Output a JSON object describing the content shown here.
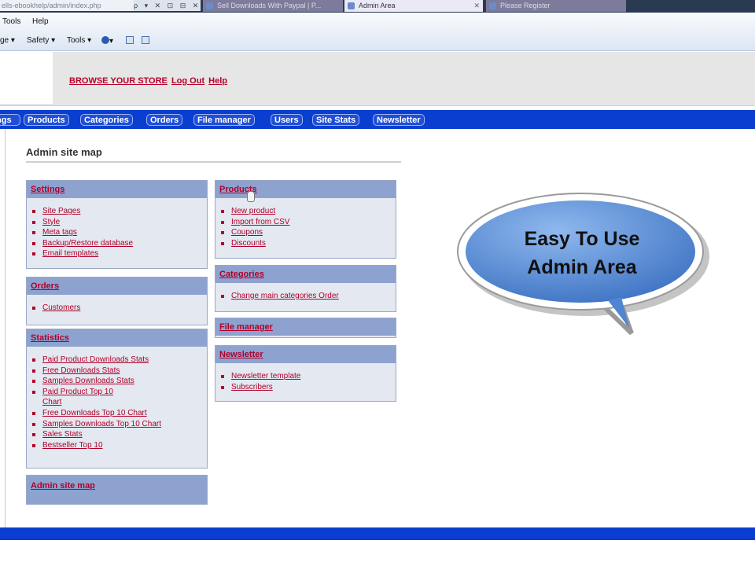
{
  "browser": {
    "address": "ells-ebookhelp/admin/index.php",
    "tabs": [
      "Sell Downloads With Paypal | P...",
      "Admin Area",
      "Please Register"
    ],
    "menu": [
      "Tools",
      "Help"
    ],
    "toolbar": [
      "ge ▾",
      "Safety ▾",
      "Tools ▾",
      "▾"
    ]
  },
  "header": {
    "links": [
      "BROWSE YOUR STORE",
      "Log Out",
      "Help"
    ]
  },
  "nav": {
    "items": [
      "ngs",
      "Products",
      "Categories",
      "Orders",
      "File manager",
      "Users",
      "Site Stats",
      "Newsletter"
    ]
  },
  "main": {
    "title": "Admin site map",
    "boxes": {
      "settings": {
        "title": "Settings",
        "items": [
          "Site Pages",
          "Style",
          "Meta tags",
          "Backup/Restore database",
          "Email templates"
        ]
      },
      "orders": {
        "title": "Orders",
        "items": [
          "Customers"
        ]
      },
      "statistics": {
        "title": "Statistics",
        "items": [
          "Paid Product Downloads Stats",
          "Free Downloads Stats",
          "Samples Downloads Stats",
          "Paid Product Top 10",
          "Chart",
          "Free Downloads Top 10 Chart",
          "Samples Downloads Top 10 Chart",
          "Sales Stats",
          "Bestseller Top 10"
        ]
      },
      "sitemap": {
        "title": "Admin site map"
      },
      "products": {
        "title": "Products",
        "items": [
          "New product",
          "Import from CSV",
          "Coupons",
          "Discounts"
        ]
      },
      "categories": {
        "title": "Categories",
        "items": [
          "Change main categories Order"
        ]
      },
      "filemanager": {
        "title": "File manager"
      },
      "newsletter": {
        "title": "Newsletter",
        "items": [
          "Newsletter template",
          "Subscribers"
        ]
      }
    }
  },
  "callout": {
    "line1": "Easy To Use",
    "line2": "Admin Area"
  },
  "colors": {
    "nav_blue": "#0a3ed0",
    "link_red": "#b0002a",
    "box_header": "#8da2cf",
    "bubble_blue": "#5b8fd8"
  }
}
